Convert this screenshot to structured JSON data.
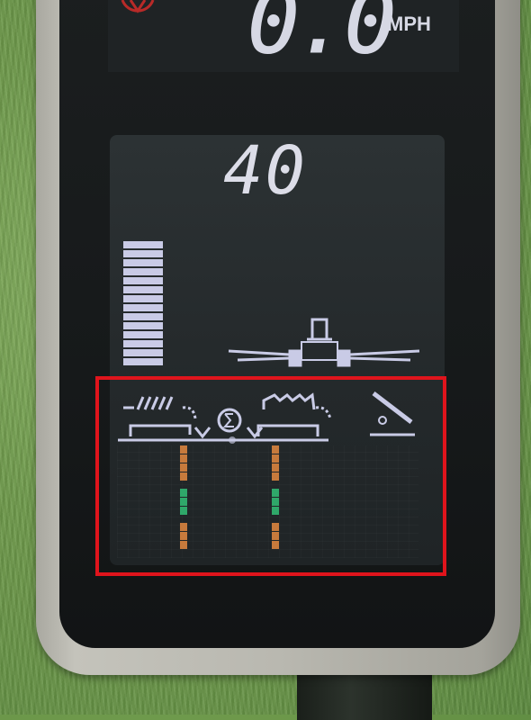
{
  "speed_display": {
    "value": "0.0",
    "unit": "MPH"
  },
  "main_display": {
    "value": "40",
    "level_bar": {
      "segments_lit": 14,
      "segments_total": 14
    }
  },
  "icons": {
    "warning": "red-circle-warning-icon",
    "tractor": "tractor-sprayer-boom-icon",
    "rear_hitch": "rear-hitch-raise-icon",
    "front_hitch": "front-hitch-icon",
    "sum": "sigma-icon",
    "settings": "gear-lever-icon"
  },
  "gauges": {
    "left": {
      "orange_top": true,
      "green_mid": true,
      "orange_bottom": true
    },
    "right": {
      "orange_top": true,
      "green_mid": true,
      "orange_bottom": true
    }
  },
  "colors": {
    "lcd_text": "#dcdde8",
    "gauge_orange": "#c77a3c",
    "gauge_green": "#2fa86a",
    "highlight": "#e0141c"
  }
}
